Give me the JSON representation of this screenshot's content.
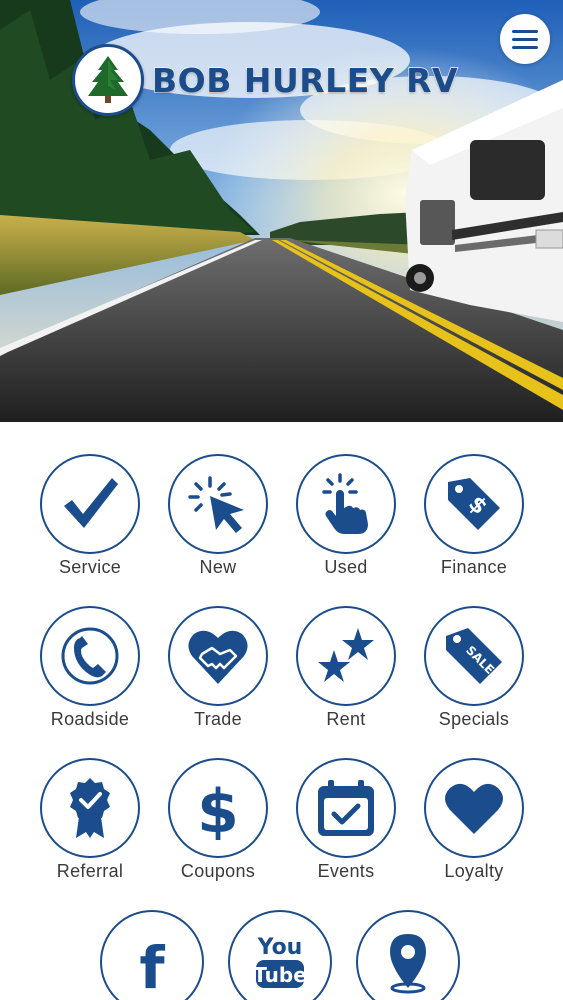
{
  "brand": {
    "name": "BOB HURLEY RV",
    "primary_color": "#1b4d8c"
  },
  "header": {
    "menu_icon": "hamburger-icon"
  },
  "tiles": [
    {
      "label": "Service",
      "icon": "checkmark-icon"
    },
    {
      "label": "New",
      "icon": "cursor-click-icon"
    },
    {
      "label": "Used",
      "icon": "tap-hand-icon"
    },
    {
      "label": "Finance",
      "icon": "price-tag-dollar-icon"
    },
    {
      "label": "Roadside",
      "icon": "phone-icon"
    },
    {
      "label": "Trade",
      "icon": "handshake-heart-icon"
    },
    {
      "label": "Rent",
      "icon": "stars-icon"
    },
    {
      "label": "Specials",
      "icon": "sale-tag-icon"
    },
    {
      "label": "Referral",
      "icon": "award-ribbon-icon"
    },
    {
      "label": "Coupons",
      "icon": "dollar-sign-icon"
    },
    {
      "label": "Events",
      "icon": "calendar-check-icon"
    },
    {
      "label": "Loyalty",
      "icon": "heart-icon"
    }
  ],
  "social": [
    {
      "icon": "facebook-icon",
      "text": "f"
    },
    {
      "icon": "youtube-icon",
      "text_top": "You",
      "text_bottom": "Tube"
    },
    {
      "icon": "location-pin-icon"
    }
  ]
}
